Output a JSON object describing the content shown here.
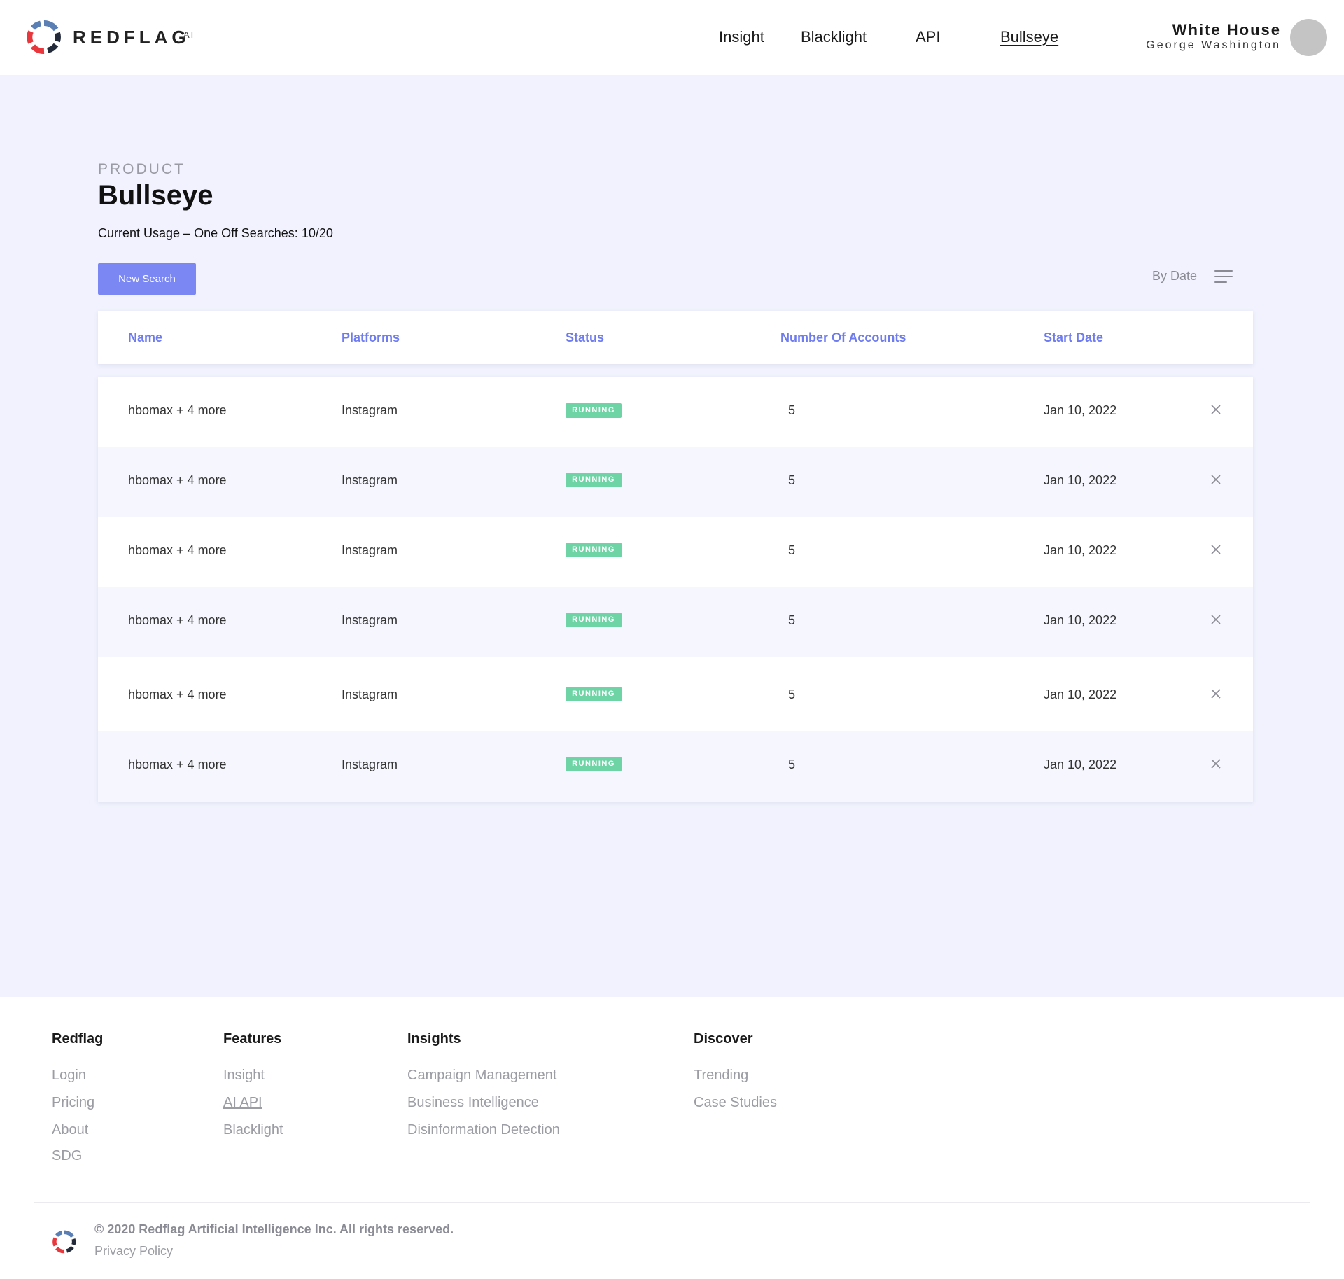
{
  "header": {
    "brand": "REDFLAG",
    "brand_sup": "AI",
    "nav": [
      "Insight",
      "Blacklight",
      "API",
      "Bullseye"
    ],
    "active_nav": "Bullseye",
    "account_name": "White House",
    "account_user": "George Washington"
  },
  "page": {
    "eyebrow": "PRODUCT",
    "title": "Bullseye",
    "usage": "Current Usage – One Off Searches: 10/20",
    "new_search_label": "New Search",
    "sort_label": "By Date"
  },
  "table": {
    "columns": [
      "Name",
      "Platforms",
      "Status",
      "Number Of Accounts",
      "Start Date"
    ],
    "rows": [
      {
        "name": "hbomax + 4 more",
        "platform": "Instagram",
        "status": "RUNNING",
        "accounts": "5",
        "start_date": "Jan 10, 2022"
      },
      {
        "name": "hbomax + 4 more",
        "platform": "Instagram",
        "status": "RUNNING",
        "accounts": "5",
        "start_date": "Jan 10, 2022"
      },
      {
        "name": "hbomax + 4 more",
        "platform": "Instagram",
        "status": "RUNNING",
        "accounts": "5",
        "start_date": "Jan 10, 2022"
      },
      {
        "name": "hbomax + 4 more",
        "platform": "Instagram",
        "status": "RUNNING",
        "accounts": "5",
        "start_date": "Jan 10, 2022"
      },
      {
        "name": "hbomax + 4 more",
        "platform": "Instagram",
        "status": "RUNNING",
        "accounts": "5",
        "start_date": "Jan 10, 2022"
      },
      {
        "name": "hbomax + 4 more",
        "platform": "Instagram",
        "status": "RUNNING",
        "accounts": "5",
        "start_date": "Jan 10, 2022"
      }
    ]
  },
  "footer": {
    "columns": [
      {
        "title": "Redflag",
        "links": [
          "Login",
          "Pricing",
          "About",
          "SDG"
        ]
      },
      {
        "title": "Features",
        "links": [
          "Insight",
          "AI API",
          "Blacklight"
        ]
      },
      {
        "title": "Insights",
        "links": [
          "Campaign Management",
          "Business Intelligence",
          "Disinformation Detection"
        ]
      },
      {
        "title": "Discover",
        "links": [
          "Trending",
          "Case Studies"
        ]
      }
    ],
    "copyright": "© 2020 Redflag Artificial Intelligence Inc. All rights reserved.",
    "privacy": "Privacy Policy"
  },
  "colors": {
    "accent": "#7b88f4",
    "column_header": "#6e7cf0",
    "status_running": "#6ed3a5",
    "page_bg": "#f1f2fd",
    "logo_red": "#e8383d",
    "logo_blue": "#5a7fb5",
    "logo_dark": "#232a3a"
  }
}
